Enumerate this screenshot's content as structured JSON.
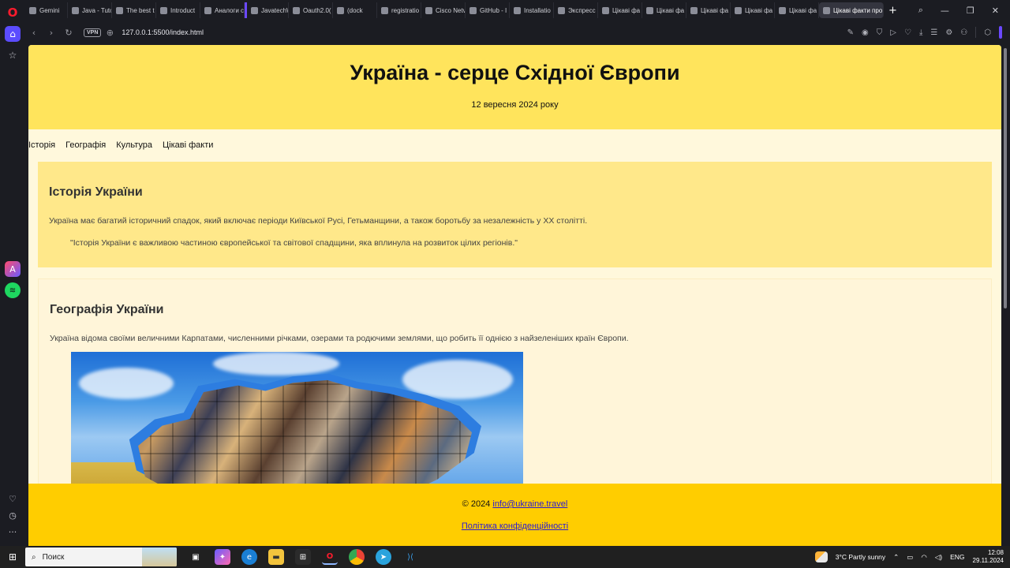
{
  "browser": {
    "tabs": [
      {
        "label": "Gemini",
        "active": false
      },
      {
        "label": "Java - Tuto",
        "active": false
      },
      {
        "label": "The best t",
        "active": false
      },
      {
        "label": "Introduct",
        "active": false
      },
      {
        "label": "Аналоги с",
        "active": false
      },
      {
        "label": "JavatechW",
        "active": false
      },
      {
        "label": "Oauth2.0(",
        "active": false
      },
      {
        "label": "(dock",
        "active": false
      },
      {
        "label": "registratio",
        "active": false
      },
      {
        "label": "Cisco Netv",
        "active": false
      },
      {
        "label": "GitHub - I",
        "active": false
      },
      {
        "label": "Installatio",
        "active": false
      },
      {
        "label": "Экспресс",
        "active": false
      },
      {
        "label": "Цікаві фа",
        "active": false
      },
      {
        "label": "Цікаві фа",
        "active": false
      },
      {
        "label": "Цікаві фа",
        "active": false
      },
      {
        "label": "Цікаві фа",
        "active": false
      },
      {
        "label": "Цікаві фа",
        "active": false
      },
      {
        "label": "Цікаві факти про",
        "active": true
      }
    ],
    "vpn_label": "VPN",
    "url": "127.0.0.1:5500/index.html"
  },
  "site": {
    "title": "Україна - серце Східної Європи",
    "date": "12 вересня 2024 року",
    "nav": [
      "Історія",
      "Географія",
      "Культура",
      "Цікаві факти"
    ],
    "history": {
      "heading": "Історія України",
      "text": "Україна має багатий історичний спадок, який включає періоди Київської Русі, Гетьманщини, а також боротьбу за незалежність у XX столітті.",
      "quote": "\"Історія України є важливою частиною європейської та світової спадщини, яка вплинула на розвиток цілих регіонів.\""
    },
    "geography": {
      "heading": "Географія України",
      "text": "Україна відома своїми величними Карпатами, численними річками, озерами та родючими землями, що робить її однією з найзеленіших країн Європи."
    },
    "footer": {
      "copyright": "© 2024",
      "email": "info@ukraine.travel",
      "policy": "Політика конфіденційності"
    }
  },
  "taskbar": {
    "search_placeholder": "Поиск",
    "weather": "3°C  Partly sunny",
    "lang": "ENG",
    "time": "12:08",
    "date": "29.11.2024"
  },
  "colors": {
    "header_bg": "#ffe45c",
    "history_bg": "#ffe88a",
    "page_bg": "#fff8dc",
    "footer_bg": "#ffcd00"
  }
}
